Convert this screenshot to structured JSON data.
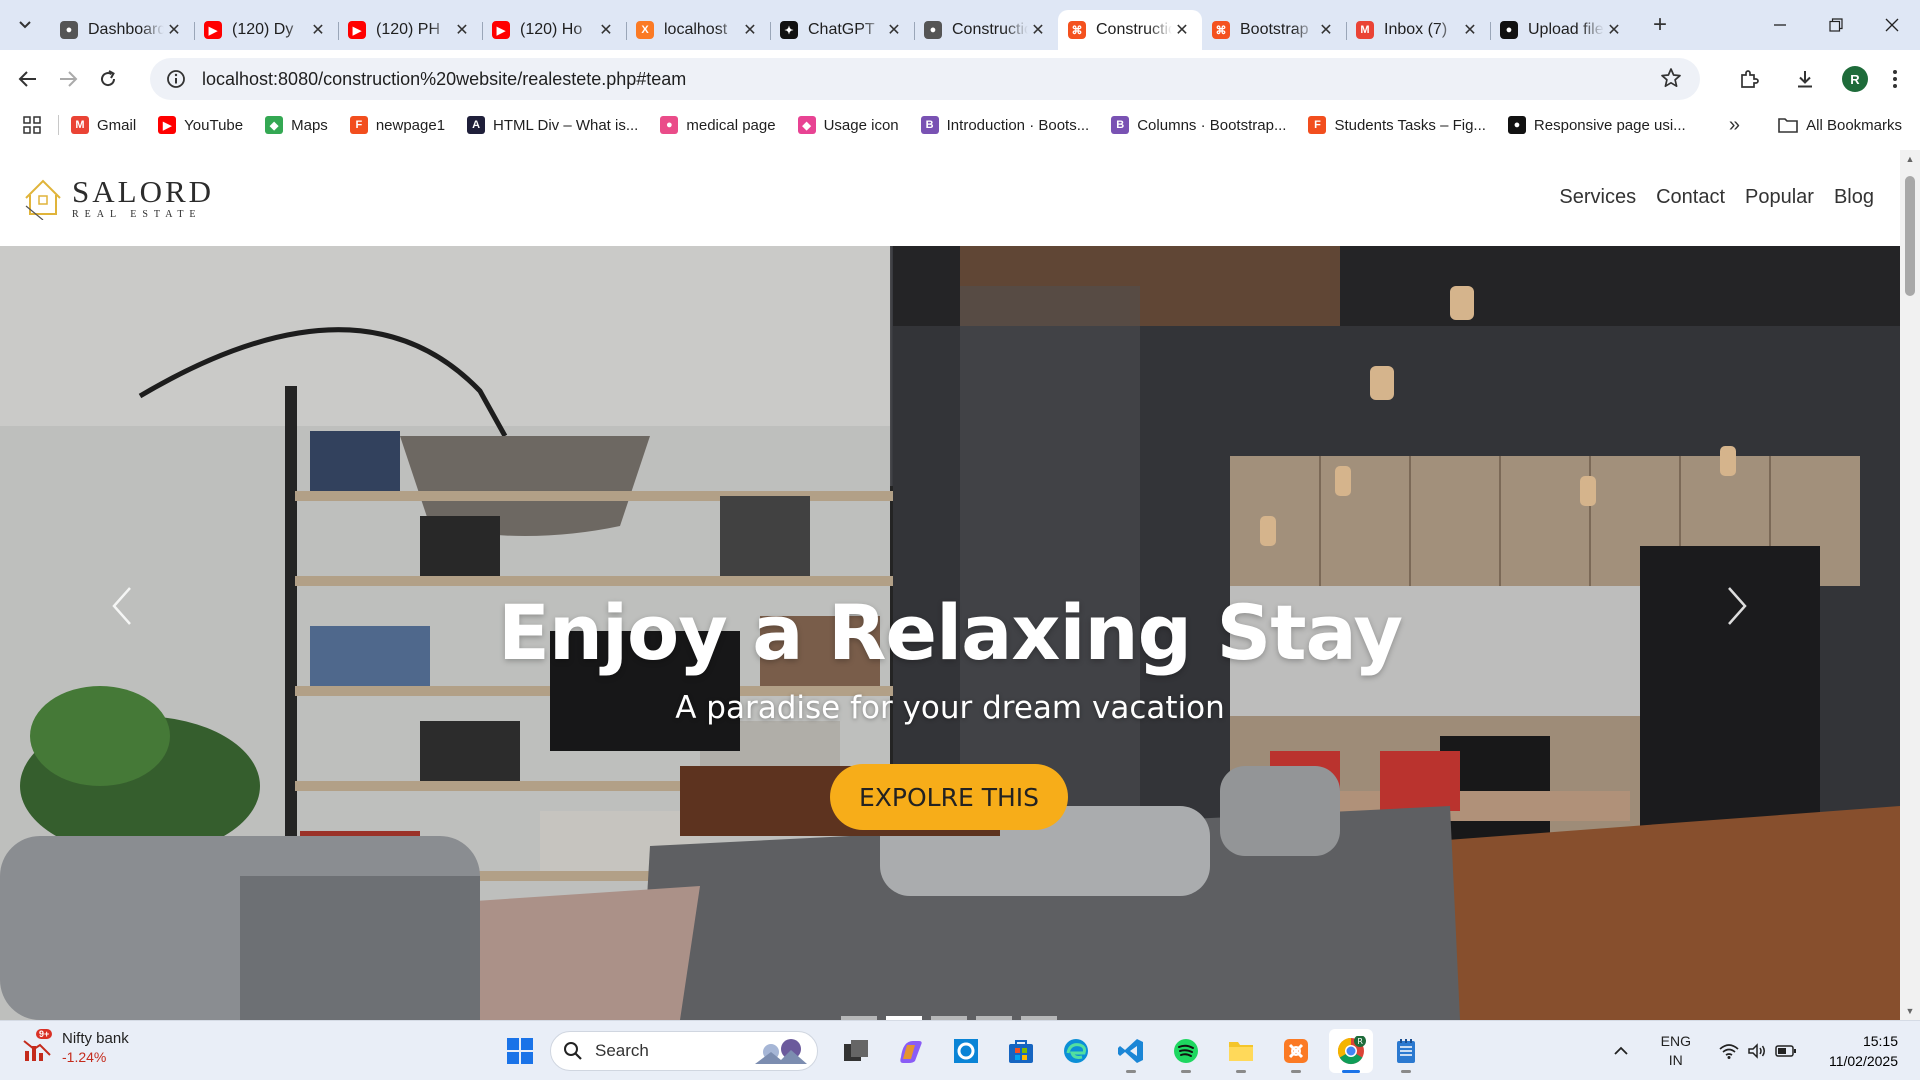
{
  "browser": {
    "tabs": [
      {
        "title": "Dashboard",
        "icon": "globe-icon",
        "color": "#555555"
      },
      {
        "title": "(120) Dy",
        "icon": "youtube-icon",
        "color": "#ff0000"
      },
      {
        "title": "(120) PH",
        "icon": "youtube-icon",
        "color": "#ff0000"
      },
      {
        "title": "(120) Ho",
        "icon": "youtube-icon",
        "color": "#ff0000"
      },
      {
        "title": "localhost",
        "icon": "xampp-icon",
        "color": "#fb7a24"
      },
      {
        "title": "ChatGPT",
        "icon": "chatgpt-icon",
        "color": "#111111"
      },
      {
        "title": "Construction",
        "icon": "globe-icon",
        "color": "#555555"
      },
      {
        "title": "Construction",
        "icon": "construction-icon",
        "color": "#f4511e",
        "active": true
      },
      {
        "title": "Bootstrap",
        "icon": "construction-icon",
        "color": "#f4511e"
      },
      {
        "title": "Inbox (7)",
        "icon": "gmail-icon",
        "color": "#ea4335"
      },
      {
        "title": "Upload files",
        "icon": "github-icon",
        "color": "#111111"
      }
    ],
    "url": "localhost:8080/construction%20website/realestete.php#team",
    "profile_initial": "R"
  },
  "bookmarks": {
    "items": [
      {
        "label": "Gmail",
        "icon": "gmail-icon",
        "color": "#ea4335"
      },
      {
        "label": "YouTube",
        "icon": "youtube-icon",
        "color": "#ff0000"
      },
      {
        "label": "Maps",
        "icon": "maps-icon",
        "color": "#34a853"
      },
      {
        "label": "newpage1",
        "icon": "figma-icon",
        "color": "#f24e1e"
      },
      {
        "label": "HTML Div – What is...",
        "icon": "codecademy-icon",
        "color": "#1f1f3a"
      },
      {
        "label": "medical page",
        "icon": "dribbble-icon",
        "color": "#ea4c89"
      },
      {
        "label": "Usage icon",
        "icon": "usage-icon",
        "color": "#e84393"
      },
      {
        "label": "Introduction · Boots...",
        "icon": "bootstrap-icon",
        "color": "#7952b3"
      },
      {
        "label": "Columns · Bootstrap...",
        "icon": "bootstrap-icon",
        "color": "#7952b3"
      },
      {
        "label": "Students Tasks – Fig...",
        "icon": "figma-icon",
        "color": "#f24e1e"
      },
      {
        "label": "Responsive page usi...",
        "icon": "github-icon",
        "color": "#111111"
      }
    ],
    "all_label": "All Bookmarks"
  },
  "site": {
    "logo_name": "SALORD",
    "logo_sub": "REAL ESTATE",
    "nav": [
      "Services",
      "Contact",
      "Popular",
      "Blog"
    ],
    "hero": {
      "title": "Enjoy a Relaxing Stay",
      "subtitle": "A paradise for your dream vacation",
      "button": "EXPOLRE THIS",
      "slides": 5,
      "active_slide": 2
    },
    "accent_color": "#f7ad19"
  },
  "taskbar": {
    "widget_title": "Nifty bank",
    "widget_change": "-1.24%",
    "widget_badge": "9+",
    "search_label": "Search",
    "lang_line1": "ENG",
    "lang_line2": "IN",
    "time": "15:15",
    "date": "11/02/2025"
  }
}
